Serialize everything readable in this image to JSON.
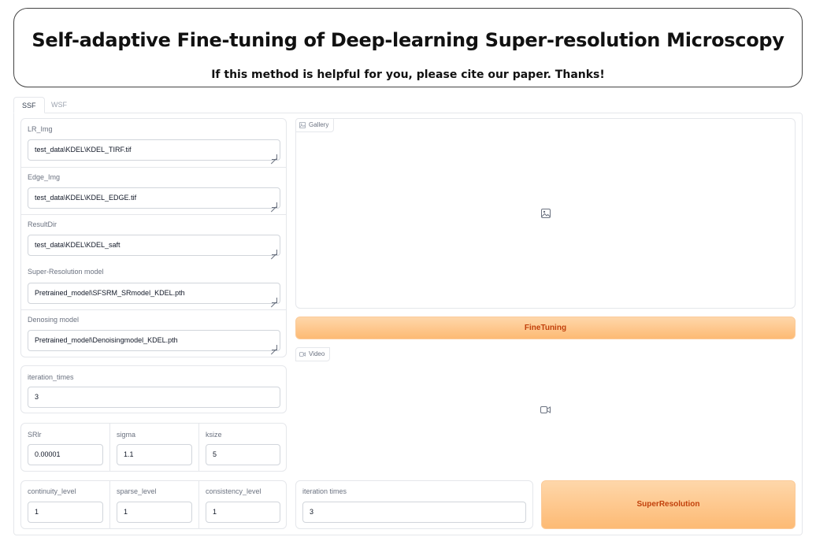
{
  "header": {
    "title": "Self-adaptive Fine-tuning of Deep-learning Super-resolution Microscopy",
    "subtitle": "If this method is helpful for you, please cite our paper. Thanks!"
  },
  "tabs": [
    {
      "label": "SSF",
      "active": true
    },
    {
      "label": "WSF",
      "active": false
    }
  ],
  "inputs": {
    "lr_img": {
      "label": "LR_Img",
      "value": "test_data\\KDEL\\KDEL_TIRF.tif"
    },
    "edge_img": {
      "label": "Edge_Img",
      "value": "test_data\\KDEL\\KDEL_EDGE.tif"
    },
    "result_dir": {
      "label": "ResultDir",
      "value": "test_data\\KDEL\\KDEL_saft"
    },
    "sr_model": {
      "label": "Super-Resolution model",
      "value": "Pretrained_model\\SFSRM_SRmodel_KDEL.pth"
    },
    "denoise_model": {
      "label": "Denosing model",
      "value": "Pretrained_model\\Denoisingmodel_KDEL.pth"
    },
    "iteration_times": {
      "label": "iteration_times",
      "value": "3"
    },
    "srlr": {
      "label": "SRlr",
      "value": "0.00001"
    },
    "sigma": {
      "label": "sigma",
      "value": "1.1"
    },
    "ksize": {
      "label": "ksize",
      "value": "5"
    },
    "continuity_level": {
      "label": "continuity_level",
      "value": "1"
    },
    "sparse_level": {
      "label": "sparse_level",
      "value": "1"
    },
    "consistency_level": {
      "label": "consistency_level",
      "value": "1"
    },
    "iteration_times_sr": {
      "label": "iteration times",
      "value": "3"
    }
  },
  "gallery": {
    "label": "Gallery",
    "icon": "image-icon"
  },
  "video": {
    "label": "Video",
    "icon": "video-icon"
  },
  "buttons": {
    "finetuning": "FineTuning",
    "superresolution": "SuperResolution"
  },
  "colors": {
    "button_bg_top": "#fed7aa",
    "button_bg_bottom": "#fdba74",
    "button_text": "#c2410c"
  }
}
